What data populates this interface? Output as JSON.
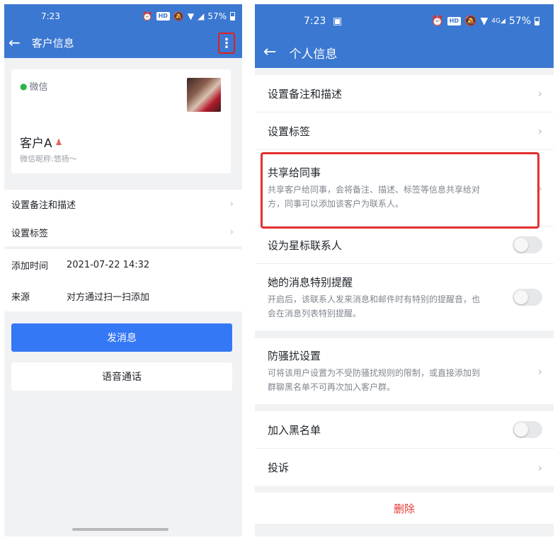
{
  "left": {
    "status": {
      "time": "7:23",
      "battery": "57%",
      "hd": "HD"
    },
    "title": "客户信息",
    "card": {
      "channel": "微信",
      "name": "客户A",
      "nickname": "微信昵称:悠扬～"
    },
    "menu": [
      {
        "label": "设置备注和描述"
      },
      {
        "label": "设置标签"
      }
    ],
    "info": [
      {
        "label": "添加时间",
        "value": "2021-07-22 14:32"
      },
      {
        "label": "来源",
        "value": "对方通过扫一扫添加"
      }
    ],
    "primary_button": "发消息",
    "secondary_button": "语音通话"
  },
  "right": {
    "status": {
      "time": "7:23",
      "battery": "57%",
      "hd": "HD",
      "signal_label": "4G"
    },
    "title": "个人信息",
    "group1": [
      {
        "title": "设置备注和描述"
      },
      {
        "title": "设置标签"
      },
      {
        "title": "共享给同事",
        "desc": "共享客户给同事，会将备注、描述、标签等信息共享给对方，同事可以添加该客户为联系人。"
      },
      {
        "title": "设为星标联系人",
        "toggle": false
      },
      {
        "title": "她的消息特别提醒",
        "desc": "开启后，该联系人发来消息和邮件时有特别的提醒音，也会在消息列表特别提醒。",
        "toggle": false
      }
    ],
    "group2": [
      {
        "title": "防骚扰设置",
        "desc": "可将该用户设置为不受防骚扰规则的限制，或直接添加到群聊黑名单不可再次加入客户群。"
      }
    ],
    "group3": [
      {
        "title": "加入黑名单",
        "toggle": false
      },
      {
        "title": "投诉"
      }
    ],
    "delete_label": "删除"
  },
  "colors": {
    "appbar": "#3b78d1",
    "primary": "#3478f6",
    "highlight": "#e53030",
    "danger": "#e53935"
  }
}
